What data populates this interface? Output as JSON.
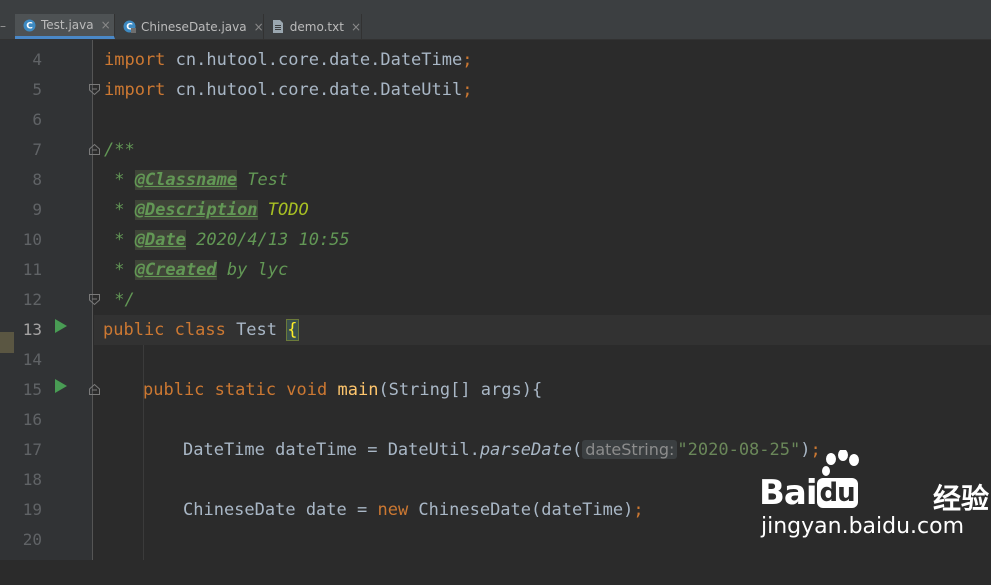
{
  "tabs": [
    {
      "label": "Test.java",
      "active": true,
      "icon": "java-class-icon"
    },
    {
      "label": "ChineseDate.java",
      "active": false,
      "icon": "java-class-icon"
    },
    {
      "label": "demo.txt",
      "active": false,
      "icon": "text-file-icon"
    }
  ],
  "close_glyph": "×",
  "editor": {
    "current_line": 13,
    "lines": [
      {
        "num": "4",
        "tokens": [
          "import",
          " cn.hutool.core.date.DateTime",
          ";"
        ]
      },
      {
        "num": "5",
        "tokens": [
          "import",
          " cn.hutool.core.date.DateUtil",
          ";"
        ]
      },
      {
        "num": "6",
        "tokens": []
      },
      {
        "num": "7",
        "tokens": [
          "/**"
        ]
      },
      {
        "num": "8",
        "tokens": [
          " * ",
          "@Classname",
          " Test"
        ]
      },
      {
        "num": "9",
        "tokens": [
          " * ",
          "@Description",
          " ",
          "TODO"
        ]
      },
      {
        "num": "10",
        "tokens": [
          " * ",
          "@Date",
          " 2020/4/13 10:55"
        ]
      },
      {
        "num": "11",
        "tokens": [
          " * ",
          "@Created",
          " by lyc"
        ]
      },
      {
        "num": "12",
        "tokens": [
          " */"
        ]
      },
      {
        "num": "13",
        "tokens": [
          "public class",
          " Test ",
          "{"
        ]
      },
      {
        "num": "14",
        "tokens": []
      },
      {
        "num": "15",
        "tokens": [
          "public static void",
          " ",
          "main",
          "(String[] args){"
        ]
      },
      {
        "num": "16",
        "tokens": []
      },
      {
        "num": "17",
        "tokens": [
          "DateTime dateTime = DateUtil.",
          "parseDate",
          "(",
          "dateString:",
          "\"2020-08-25\"",
          ")",
          ";"
        ]
      },
      {
        "num": "18",
        "tokens": []
      },
      {
        "num": "19",
        "tokens": [
          "ChineseDate date = ",
          "new",
          " ChineseDate(dateTime)",
          ";"
        ]
      },
      {
        "num": "20",
        "tokens": []
      }
    ]
  },
  "watermark": {
    "logo_left": "Bai",
    "logo_mid": "du",
    "logo_cn": "经验",
    "url": "jingyan.baidu.com"
  },
  "colors": {
    "background": "#2b2b2b",
    "keyword": "#cc7832",
    "string": "#6a8759",
    "doc_comment": "#629755",
    "method": "#ffc66d",
    "tab_accent": "#4a88c7",
    "run_icon": "#499c54"
  }
}
